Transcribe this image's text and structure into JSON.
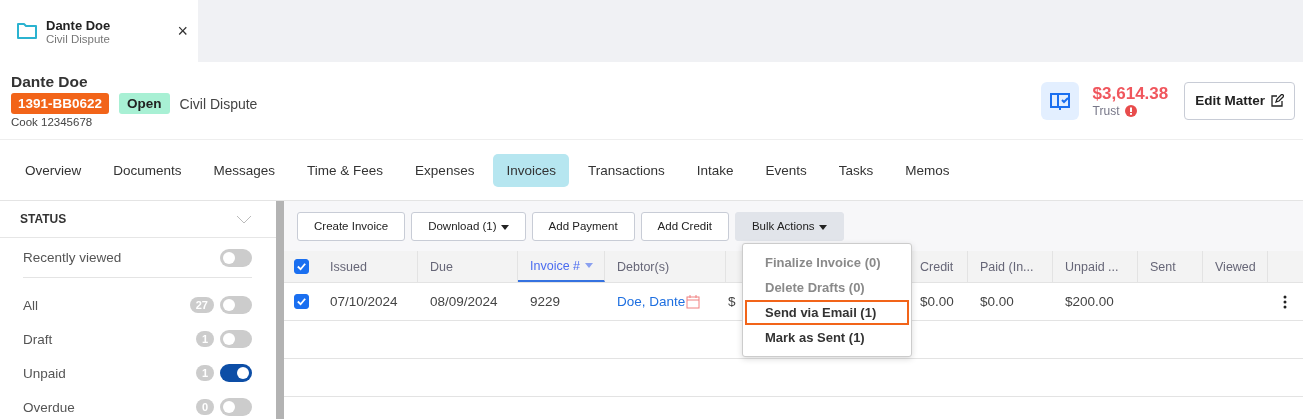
{
  "tab": {
    "title": "Dante Doe",
    "subtitle": "Civil Dispute",
    "close": "×"
  },
  "matter": {
    "name": "Dante Doe",
    "number": "1391-BB0622",
    "status": "Open",
    "type": "Civil Dispute",
    "reference": "Cook 12345678",
    "trust_amount": "$3,614.38",
    "trust_label": "Trust",
    "edit_button": "Edit Matter"
  },
  "nav": [
    {
      "label": "Overview",
      "selected": false
    },
    {
      "label": "Documents",
      "selected": false
    },
    {
      "label": "Messages",
      "selected": false
    },
    {
      "label": "Time & Fees",
      "selected": false
    },
    {
      "label": "Expenses",
      "selected": false
    },
    {
      "label": "Invoices",
      "selected": true
    },
    {
      "label": "Transactions",
      "selected": false
    },
    {
      "label": "Intake",
      "selected": false
    },
    {
      "label": "Events",
      "selected": false
    },
    {
      "label": "Tasks",
      "selected": false
    },
    {
      "label": "Memos",
      "selected": false
    }
  ],
  "sidebar": {
    "title": "STATUS",
    "recent": {
      "label": "Recently viewed",
      "on": false
    },
    "filters": [
      {
        "label": "All",
        "count": "27",
        "on": false
      },
      {
        "label": "Draft",
        "count": "1",
        "on": false
      },
      {
        "label": "Unpaid",
        "count": "1",
        "on": true
      },
      {
        "label": "Overdue",
        "count": "0",
        "on": false
      }
    ]
  },
  "toolbar": [
    {
      "label": "Create Invoice",
      "caret": false,
      "kind": "plain"
    },
    {
      "label": "Download (1)",
      "caret": true,
      "kind": "plain"
    },
    {
      "label": "Add Payment",
      "caret": false,
      "kind": "plain"
    },
    {
      "label": "Add Credit",
      "caret": false,
      "kind": "plain"
    },
    {
      "label": "Bulk Actions",
      "caret": true,
      "kind": "menu"
    }
  ],
  "table": {
    "all_checked": true,
    "columns": [
      {
        "label": "Issued",
        "sorted": false
      },
      {
        "label": "Due",
        "sorted": false
      },
      {
        "label": "Invoice #",
        "sorted": true
      },
      {
        "label": "Debtor(s)",
        "sorted": false
      },
      {},
      {
        "label": "Credit",
        "sorted": false
      },
      {
        "label": "Paid (In...",
        "sorted": false
      },
      {
        "label": "Unpaid ...",
        "sorted": false
      },
      {
        "label": "Sent",
        "sorted": false
      },
      {
        "label": "Viewed",
        "sorted": false
      }
    ],
    "rows": [
      {
        "checked": true,
        "cells": [
          "07/10/2024",
          "08/09/2024",
          "9229",
          "Doe, Dante",
          "$",
          "$0.00",
          "$0.00",
          "$200.00",
          "",
          ""
        ]
      }
    ]
  },
  "bulk_menu": [
    {
      "label": "Finalize Invoice (0)",
      "disabled": true,
      "selected": false
    },
    {
      "label": "Delete Drafts (0)",
      "disabled": true,
      "selected": false
    },
    {
      "label": "Send via Email (1)",
      "disabled": false,
      "selected": true
    },
    {
      "label": "Mark as Sent (1)",
      "disabled": false,
      "selected": false
    }
  ]
}
